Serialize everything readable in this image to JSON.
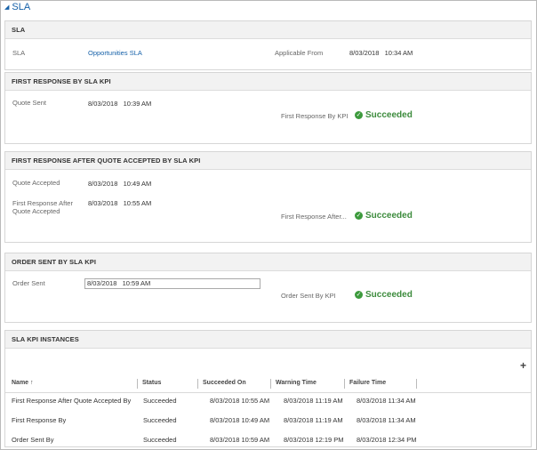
{
  "section": {
    "title": "SLA"
  },
  "sla_panel": {
    "header": "SLA",
    "sla_label": "SLA",
    "sla_value": "Opportunities SLA",
    "applicable_label": "Applicable From",
    "applicable_value": "8/03/2018   10:34 AM"
  },
  "first_response": {
    "header": "FIRST RESPONSE BY SLA KPI",
    "quote_sent_label": "Quote Sent",
    "quote_sent_value": "8/03/2018   10:39 AM",
    "kpi_label": "First Response By KPI",
    "status": "Succeeded"
  },
  "after_quote": {
    "header": "FIRST RESPONSE AFTER QUOTE ACCEPTED BY SLA KPI",
    "quote_accepted_label": "Quote Accepted",
    "quote_accepted_value": "8/03/2018   10:49 AM",
    "first_response_label_1": "First Response After",
    "first_response_label_2": "Quote Accepted",
    "first_response_value": "8/03/2018   10:55 AM",
    "kpi_label": "First Response After...",
    "status": "Succeeded"
  },
  "order_sent": {
    "header": "ORDER SENT BY SLA KPI",
    "order_sent_label": "Order Sent",
    "order_sent_value": "8/03/2018   10:59 AM",
    "kpi_label": "Order Sent By KPI",
    "status": "Succeeded"
  },
  "instances": {
    "header": "SLA KPI INSTANCES",
    "add_icon": "+",
    "columns": [
      "Name ↑",
      "Status",
      "Succeeded On",
      "Warning Time",
      "Failure Time"
    ],
    "rows": [
      {
        "name": "First Response After Quote Accepted By",
        "status": "Succeeded",
        "succeeded_on": "8/03/2018 10:55 AM",
        "warning": "8/03/2018 11:19 AM",
        "failure": "8/03/2018 11:34 AM"
      },
      {
        "name": "First Response By",
        "status": "Succeeded",
        "succeeded_on": "8/03/2018 10:49 AM",
        "warning": "8/03/2018 11:19 AM",
        "failure": "8/03/2018 11:34 AM"
      },
      {
        "name": "Order Sent By",
        "status": "Succeeded",
        "succeeded_on": "8/03/2018 10:59 AM",
        "warning": "8/03/2018 12:19 PM",
        "failure": "8/03/2018 12:34 PM"
      }
    ]
  },
  "colors": {
    "link": "#1560a8",
    "success": "#3c8b3c"
  }
}
